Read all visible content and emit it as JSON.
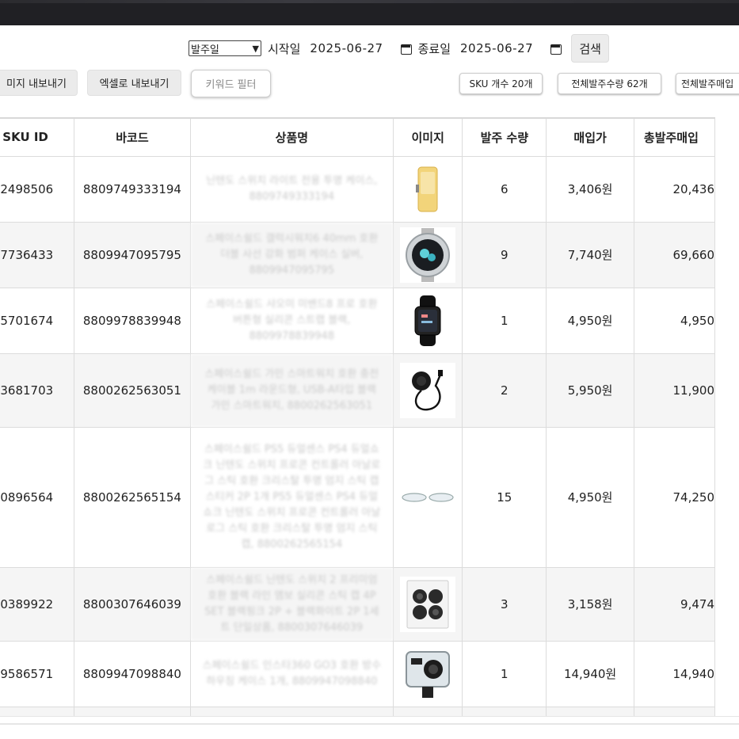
{
  "filter": {
    "date_type": "발주일",
    "start_label": "시작일",
    "start_date": "2025-06-27",
    "end_label": "종료일",
    "end_date": "2025-06-27",
    "search_label": "검색"
  },
  "actions": {
    "export_image": "미지 내보내기",
    "export_excel": "엑셀로 내보내기",
    "keyword_filter": "키워드 필터",
    "sku_count": "SKU 개수 20개",
    "total_qty": "전체발주수량 62개",
    "total_amount": "전체발주매입"
  },
  "table": {
    "headers": [
      "SKU ID",
      "바코드",
      "상품명",
      "이미지",
      "발주 수량",
      "매입가",
      "총발주매입"
    ],
    "rows": [
      {
        "sku": "2498506",
        "barcode": "8809749333194",
        "name": "닌텐도 스위치 라이트 전용 투명 케이스, 8809749333194",
        "image": "yellow-console-case-image",
        "qty": "6",
        "price": "3,406원",
        "total": "20,436"
      },
      {
        "sku": "7736433",
        "barcode": "8809947095795",
        "name": "스페이스쉴드 갤럭시워치6 40mm 호환 더블 사선 강화 범퍼 케이스 실버, 8809947095795",
        "image": "smartwatch-case-image",
        "qty": "9",
        "price": "7,740원",
        "total": "69,660"
      },
      {
        "sku": "5701674",
        "barcode": "8809978839948",
        "name": "스페이스쉴드 샤오미 미밴드8 프로 호환 버튼형 실리콘 스트랩 블랙, 8809978839948",
        "image": "black-band-image",
        "qty": "1",
        "price": "4,950원",
        "total": "4,950"
      },
      {
        "sku": "3681703",
        "barcode": "8800262563051",
        "name": "스페이스쉴드 가민 스마트워치 호환 충전 케이블 1m 라운드형, USB-A타입 블랙 가민 스마트워치, 8800262563051",
        "image": "charger-cable-image",
        "qty": "2",
        "price": "5,950원",
        "total": "11,900"
      },
      {
        "sku": "0896564",
        "barcode": "8800262565154",
        "name": "스페이스쉴드 PS5 듀얼센스 PS4 듀얼쇼크 닌텐도 스위치 프로콘 컨트롤러 아날로그 스틱 호환 크리스탈 투명 엄지 스틱 캡 스티커 2P 1개 PS5 듀얼센스 PS4 듀얼쇼크 닌텐도 스위치 프로콘 컨트롤러 아날로그 스틱 호환 크리스탈 투명 엄지 스틱 캡, 8800262565154",
        "image": "stick-cap-image",
        "qty": "15",
        "price": "4,950원",
        "total": "74,250"
      },
      {
        "sku": "0389922",
        "barcode": "8800307646039",
        "name": "스페이스쉴드 닌텐도 스위치 2 프리미엄 호환 블랙 라인 앰보 실리콘 스틱 캡 4P SET 블랙핑크 2P + 블랙화이트 2P 1세트 단일상품, 8800307646039",
        "image": "stick-cap-box-image",
        "qty": "3",
        "price": "3,158원",
        "total": "9,474"
      },
      {
        "sku": "9586571",
        "barcode": "8809947098840",
        "name": "스페이스쉴드 인스타360 GO3 호환 방수하우징 케이스 1개, 8809947098840",
        "image": "action-cam-housing-image",
        "qty": "1",
        "price": "14,940원",
        "total": "14,940"
      }
    ]
  }
}
